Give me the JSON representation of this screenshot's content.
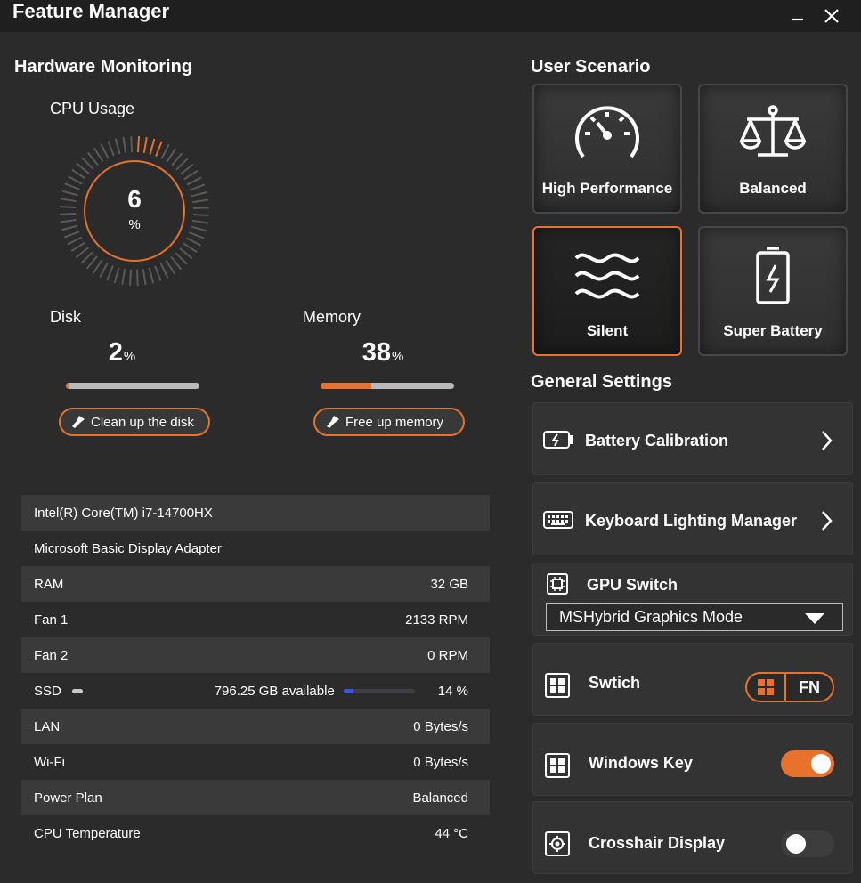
{
  "window": {
    "title": "Feature Manager"
  },
  "hardware": {
    "section_title": "Hardware Monitoring",
    "cpu": {
      "label": "CPU Usage",
      "value": "6",
      "unit": "%",
      "percent": 6
    },
    "disk": {
      "label": "Disk",
      "value": "2",
      "unit": "%",
      "percent": 2,
      "button": "Clean up the disk"
    },
    "memory": {
      "label": "Memory",
      "value": "38",
      "unit": "%",
      "percent": 38,
      "button": "Free up memory"
    },
    "info_rows": [
      {
        "name": "Intel(R) Core(TM) i7-14700HX",
        "value": ""
      },
      {
        "name": "Microsoft Basic Display Adapter",
        "value": ""
      },
      {
        "name": "RAM",
        "value": "32 GB"
      },
      {
        "name": "Fan 1",
        "value": "2133 RPM"
      },
      {
        "name": "Fan 2",
        "value": "0 RPM"
      },
      {
        "name": "SSD",
        "available": "796.25  GB available",
        "value": "14 %",
        "percent": 14
      },
      {
        "name": "LAN",
        "value": "0 Bytes/s"
      },
      {
        "name": "Wi-Fi",
        "value": "0 Bytes/s"
      },
      {
        "name": "Power Plan",
        "value": "Balanced"
      },
      {
        "name": "CPU Temperature",
        "value": "44 °C"
      }
    ]
  },
  "scenario": {
    "section_title": "User Scenario",
    "items": [
      {
        "label": "High Performance",
        "icon": "speedometer-icon",
        "active": false
      },
      {
        "label": "Balanced",
        "icon": "scales-icon",
        "active": false
      },
      {
        "label": "Silent",
        "icon": "waves-icon",
        "active": true
      },
      {
        "label": "Super Battery",
        "icon": "battery-icon",
        "active": false
      }
    ]
  },
  "general": {
    "section_title": "General Settings",
    "battery_calibration": "Battery Calibration",
    "keyboard_lighting": "Keyboard Lighting Manager",
    "gpu_switch": {
      "label": "GPU Switch",
      "selected": "MSHybrid Graphics Mode"
    },
    "swtich": {
      "label": "Swtich",
      "fn_label": "FN"
    },
    "windows_key": {
      "label": "Windows Key",
      "enabled": true
    },
    "crosshair": {
      "label": "Crosshair Display",
      "enabled": false
    }
  },
  "colors": {
    "accent": "#e8712c",
    "background": "#2b2b2b",
    "ssd_bar": "#3c50ff"
  }
}
